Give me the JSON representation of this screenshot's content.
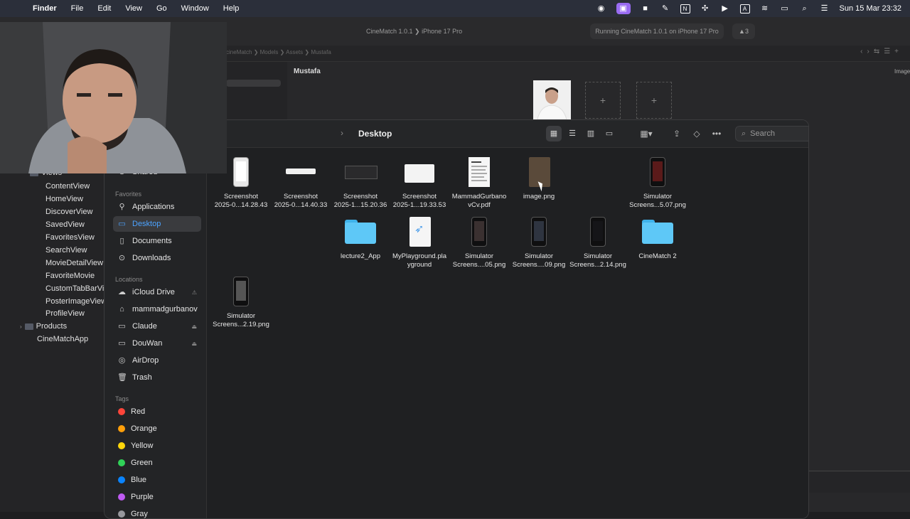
{
  "menubar": {
    "items": [
      "Finder",
      "File",
      "Edit",
      "View",
      "Go",
      "Window",
      "Help"
    ],
    "clock": "Sun 15 Mar  23:32",
    "status_icons": [
      "control-icon",
      "screen-share-icon",
      "camera-icon",
      "pen-icon",
      "notion-icon",
      "fan-icon",
      "play-icon",
      "input-a-icon",
      "wifi-icon",
      "battery-icon",
      "search-icon",
      "control-center-icon"
    ]
  },
  "xcode": {
    "scheme": "CineMatch 1.0.1",
    "device": "iPhone 17 Pro",
    "status": "Running CineMatch 1.0.1 on iPhone 17 Pro",
    "warnings": "3",
    "jump_bar": [
      "cineMatch",
      "Models",
      "Assets",
      "Mustafa"
    ],
    "asset_title": "Mustafa",
    "image_label": "Image",
    "project_nav": {
      "views_group": "Views",
      "files": [
        "ContentView",
        "HomeView",
        "DiscoverView",
        "SavedView",
        "FavoritesView",
        "SearchView",
        "MovieDetailView",
        "FavoriteMovie",
        "CustomTabBarVi",
        "PosterImageView",
        "ProfileView"
      ],
      "products": "Products",
      "app": "CineMatchApp"
    }
  },
  "finder": {
    "title": "Desktop",
    "search_placeholder": "Search",
    "sidebar": {
      "shared": "Shared",
      "favorites_header": "Favorites",
      "favorites": [
        "Applications",
        "Desktop",
        "Documents",
        "Downloads"
      ],
      "locations_header": "Locations",
      "locations": [
        "iCloud Drive",
        "mammadgurbanov",
        "Claude",
        "DouWan",
        "AirDrop",
        "Trash"
      ],
      "tags_header": "Tags",
      "tags": [
        {
          "name": "Red",
          "color": "#ff453a"
        },
        {
          "name": "Orange",
          "color": "#ff9f0a"
        },
        {
          "name": "Yellow",
          "color": "#ffd60a"
        },
        {
          "name": "Green",
          "color": "#30d158"
        },
        {
          "name": "Blue",
          "color": "#0a84ff"
        },
        {
          "name": "Purple",
          "color": "#bf5af2"
        },
        {
          "name": "Gray",
          "color": "#98989d"
        }
      ]
    },
    "files": [
      {
        "line1": "Screenshot",
        "line2": "2025-0...14.28.43"
      },
      {
        "line1": "Screenshot",
        "line2": "2025-0...14.40.33"
      },
      {
        "line1": "Screenshot",
        "line2": "2025-1...15.20.36"
      },
      {
        "line1": "Screenshot",
        "line2": "2025-1...19.33.53"
      },
      {
        "line1": "MammadGurbano",
        "line2": "vCv.pdf"
      },
      {
        "line1": "image.png",
        "line2": ""
      },
      {
        "line1": "Simulator",
        "line2": "Screens...5.07.png"
      },
      {
        "line1": "lecture2_App",
        "line2": ""
      },
      {
        "line1": "MyPlayground.pla",
        "line2": "yground"
      },
      {
        "line1": "Simulator",
        "line2": "Screens....05.png"
      },
      {
        "line1": "Simulator",
        "line2": "Screens....09.png"
      },
      {
        "line1": "Simulator",
        "line2": "Screens...2.14.png"
      },
      {
        "line1": "CineMatch 2",
        "line2": ""
      },
      {
        "line1": "Simulator",
        "line2": "Screens...2.19.png"
      }
    ]
  }
}
